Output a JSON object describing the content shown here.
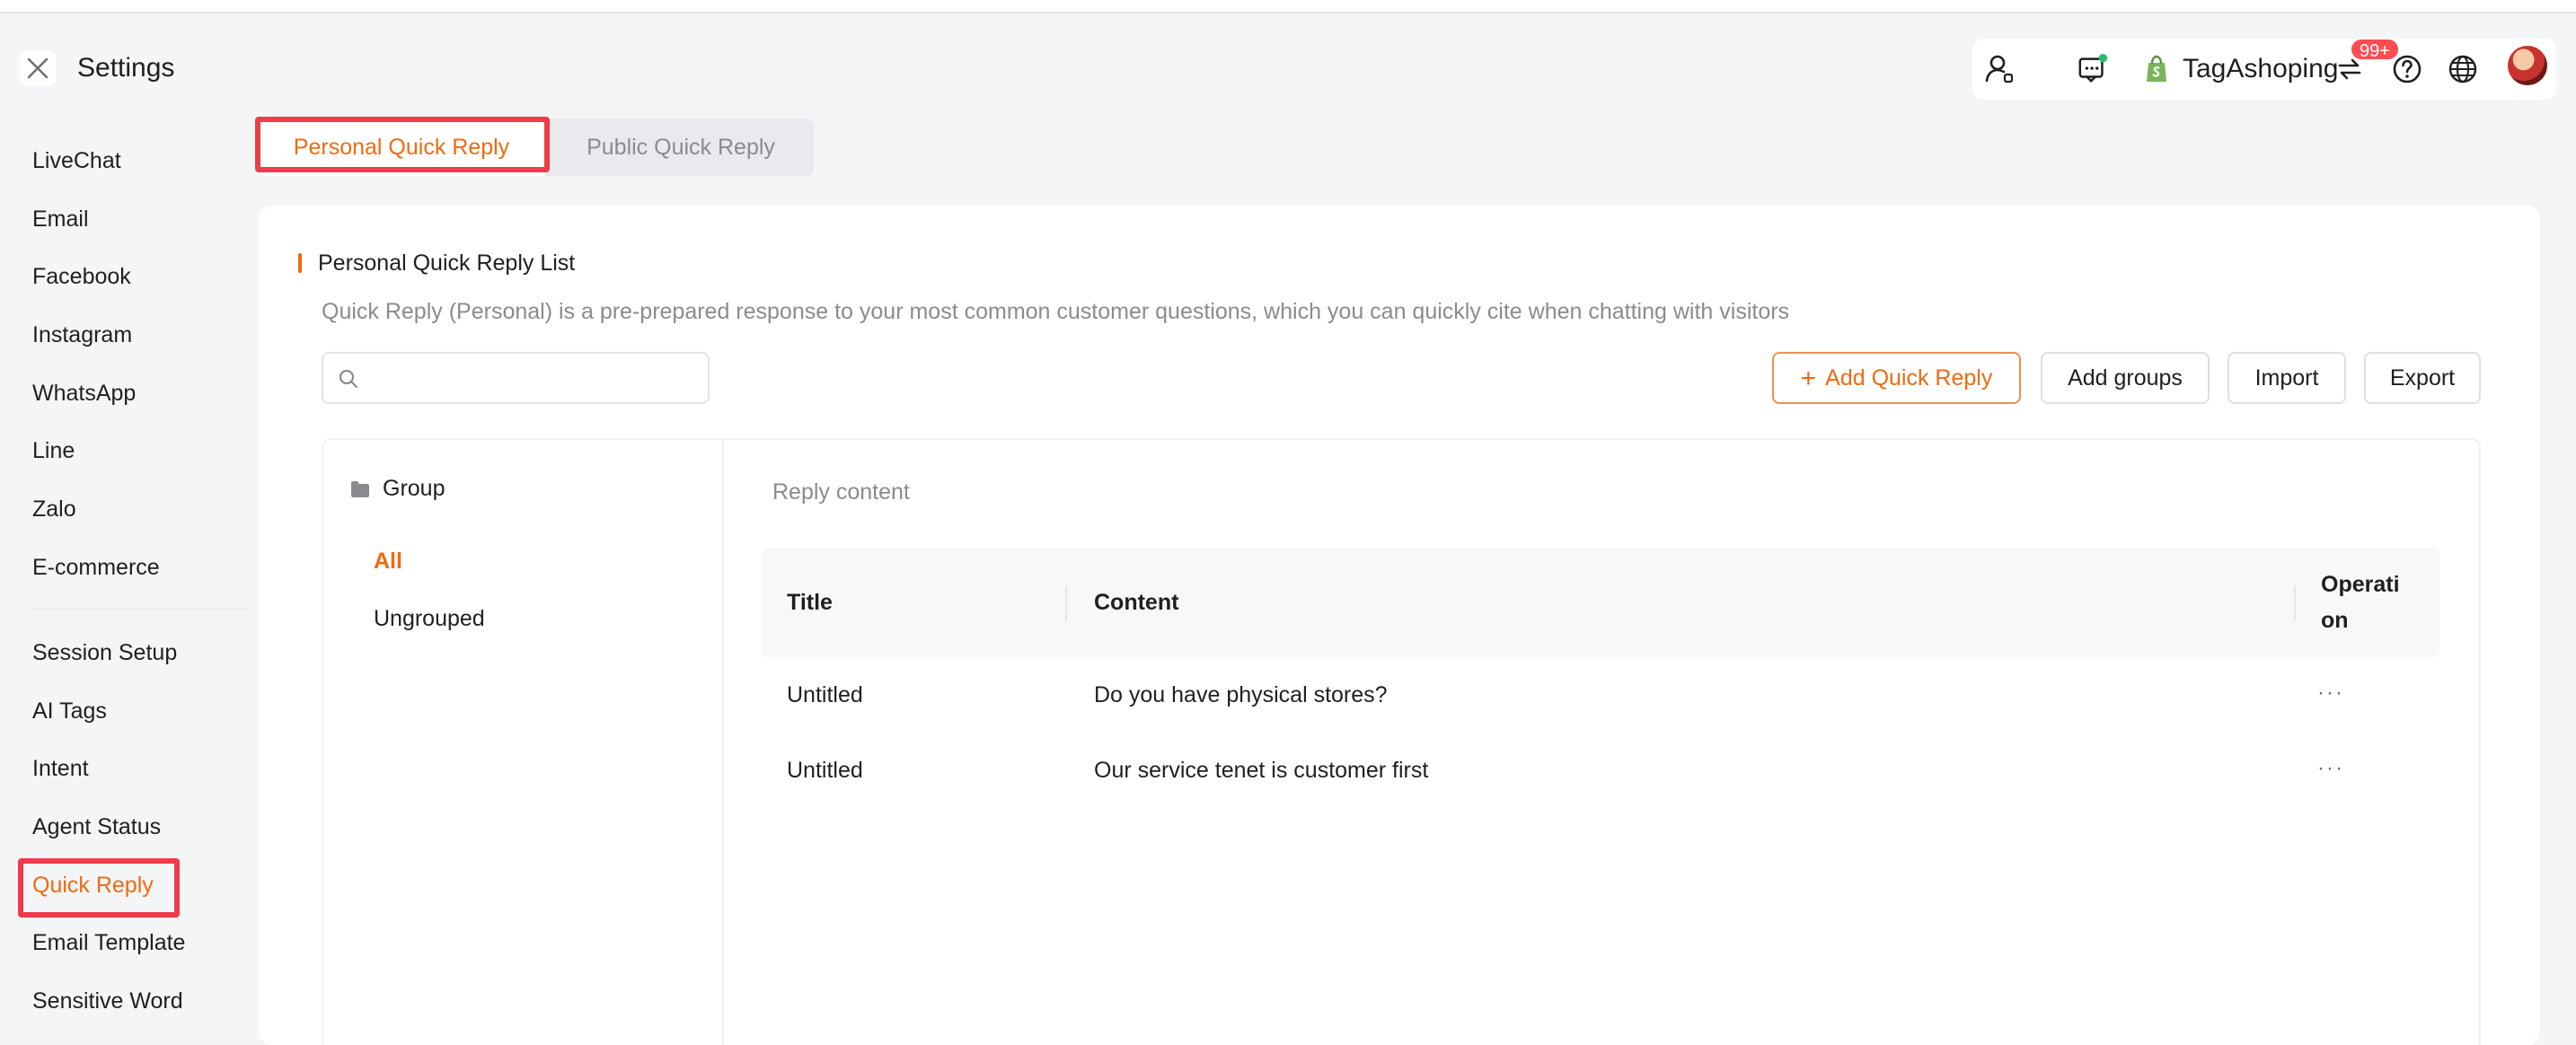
{
  "header": {
    "title": "Settings",
    "store_name": "TagAshoping",
    "notification_badge": "99+"
  },
  "sidebar": {
    "items": [
      {
        "label": "LiveChat"
      },
      {
        "label": "Email"
      },
      {
        "label": "Facebook"
      },
      {
        "label": "Instagram"
      },
      {
        "label": "WhatsApp"
      },
      {
        "label": "Line"
      },
      {
        "label": "Zalo"
      },
      {
        "label": "E-commerce"
      },
      {
        "label": "Session Setup"
      },
      {
        "label": "AI Tags"
      },
      {
        "label": "Intent"
      },
      {
        "label": "Agent Status"
      },
      {
        "label": "Quick Reply"
      },
      {
        "label": "Email Template"
      },
      {
        "label": "Sensitive Word"
      }
    ],
    "active_item": "Quick Reply"
  },
  "tabs": [
    {
      "label": "Personal Quick Reply"
    },
    {
      "label": "Public Quick Reply"
    }
  ],
  "main": {
    "section_title": "Personal Quick Reply List",
    "description": "Quick Reply (Personal) is a pre-prepared response to your most common customer questions, which you can quickly cite when chatting with visitors",
    "search": {
      "value": "",
      "placeholder": ""
    },
    "buttons": {
      "add": "Add Quick Reply",
      "add_groups": "Add groups",
      "import": "Import",
      "export": "Export"
    },
    "groups": {
      "heading": "Group",
      "items": [
        {
          "label": "All"
        },
        {
          "label": "Ungrouped"
        }
      ]
    },
    "reply_label": "Reply content",
    "table": {
      "columns": [
        "Title",
        "Content",
        "Operati on"
      ],
      "rows": [
        {
          "title": "Untitled",
          "content": "Do you have physical stores?",
          "operation": "···"
        },
        {
          "title": "Untitled",
          "content": "Our service tenet is customer first",
          "operation": "···"
        }
      ]
    }
  },
  "colors": {
    "accent": "#f06a0f",
    "highlight_box": "#ef3b4a",
    "badge": "#ff4d4f",
    "online_dot": "#2bbf6a",
    "shopify_green": "#7ab55c"
  },
  "icons": [
    "close-icon",
    "agent-icon",
    "chat-icon",
    "shopify-icon",
    "switch-icon",
    "help-icon",
    "globe-icon",
    "avatar",
    "search-icon",
    "folder-icon",
    "plus-icon",
    "more-icon"
  ]
}
